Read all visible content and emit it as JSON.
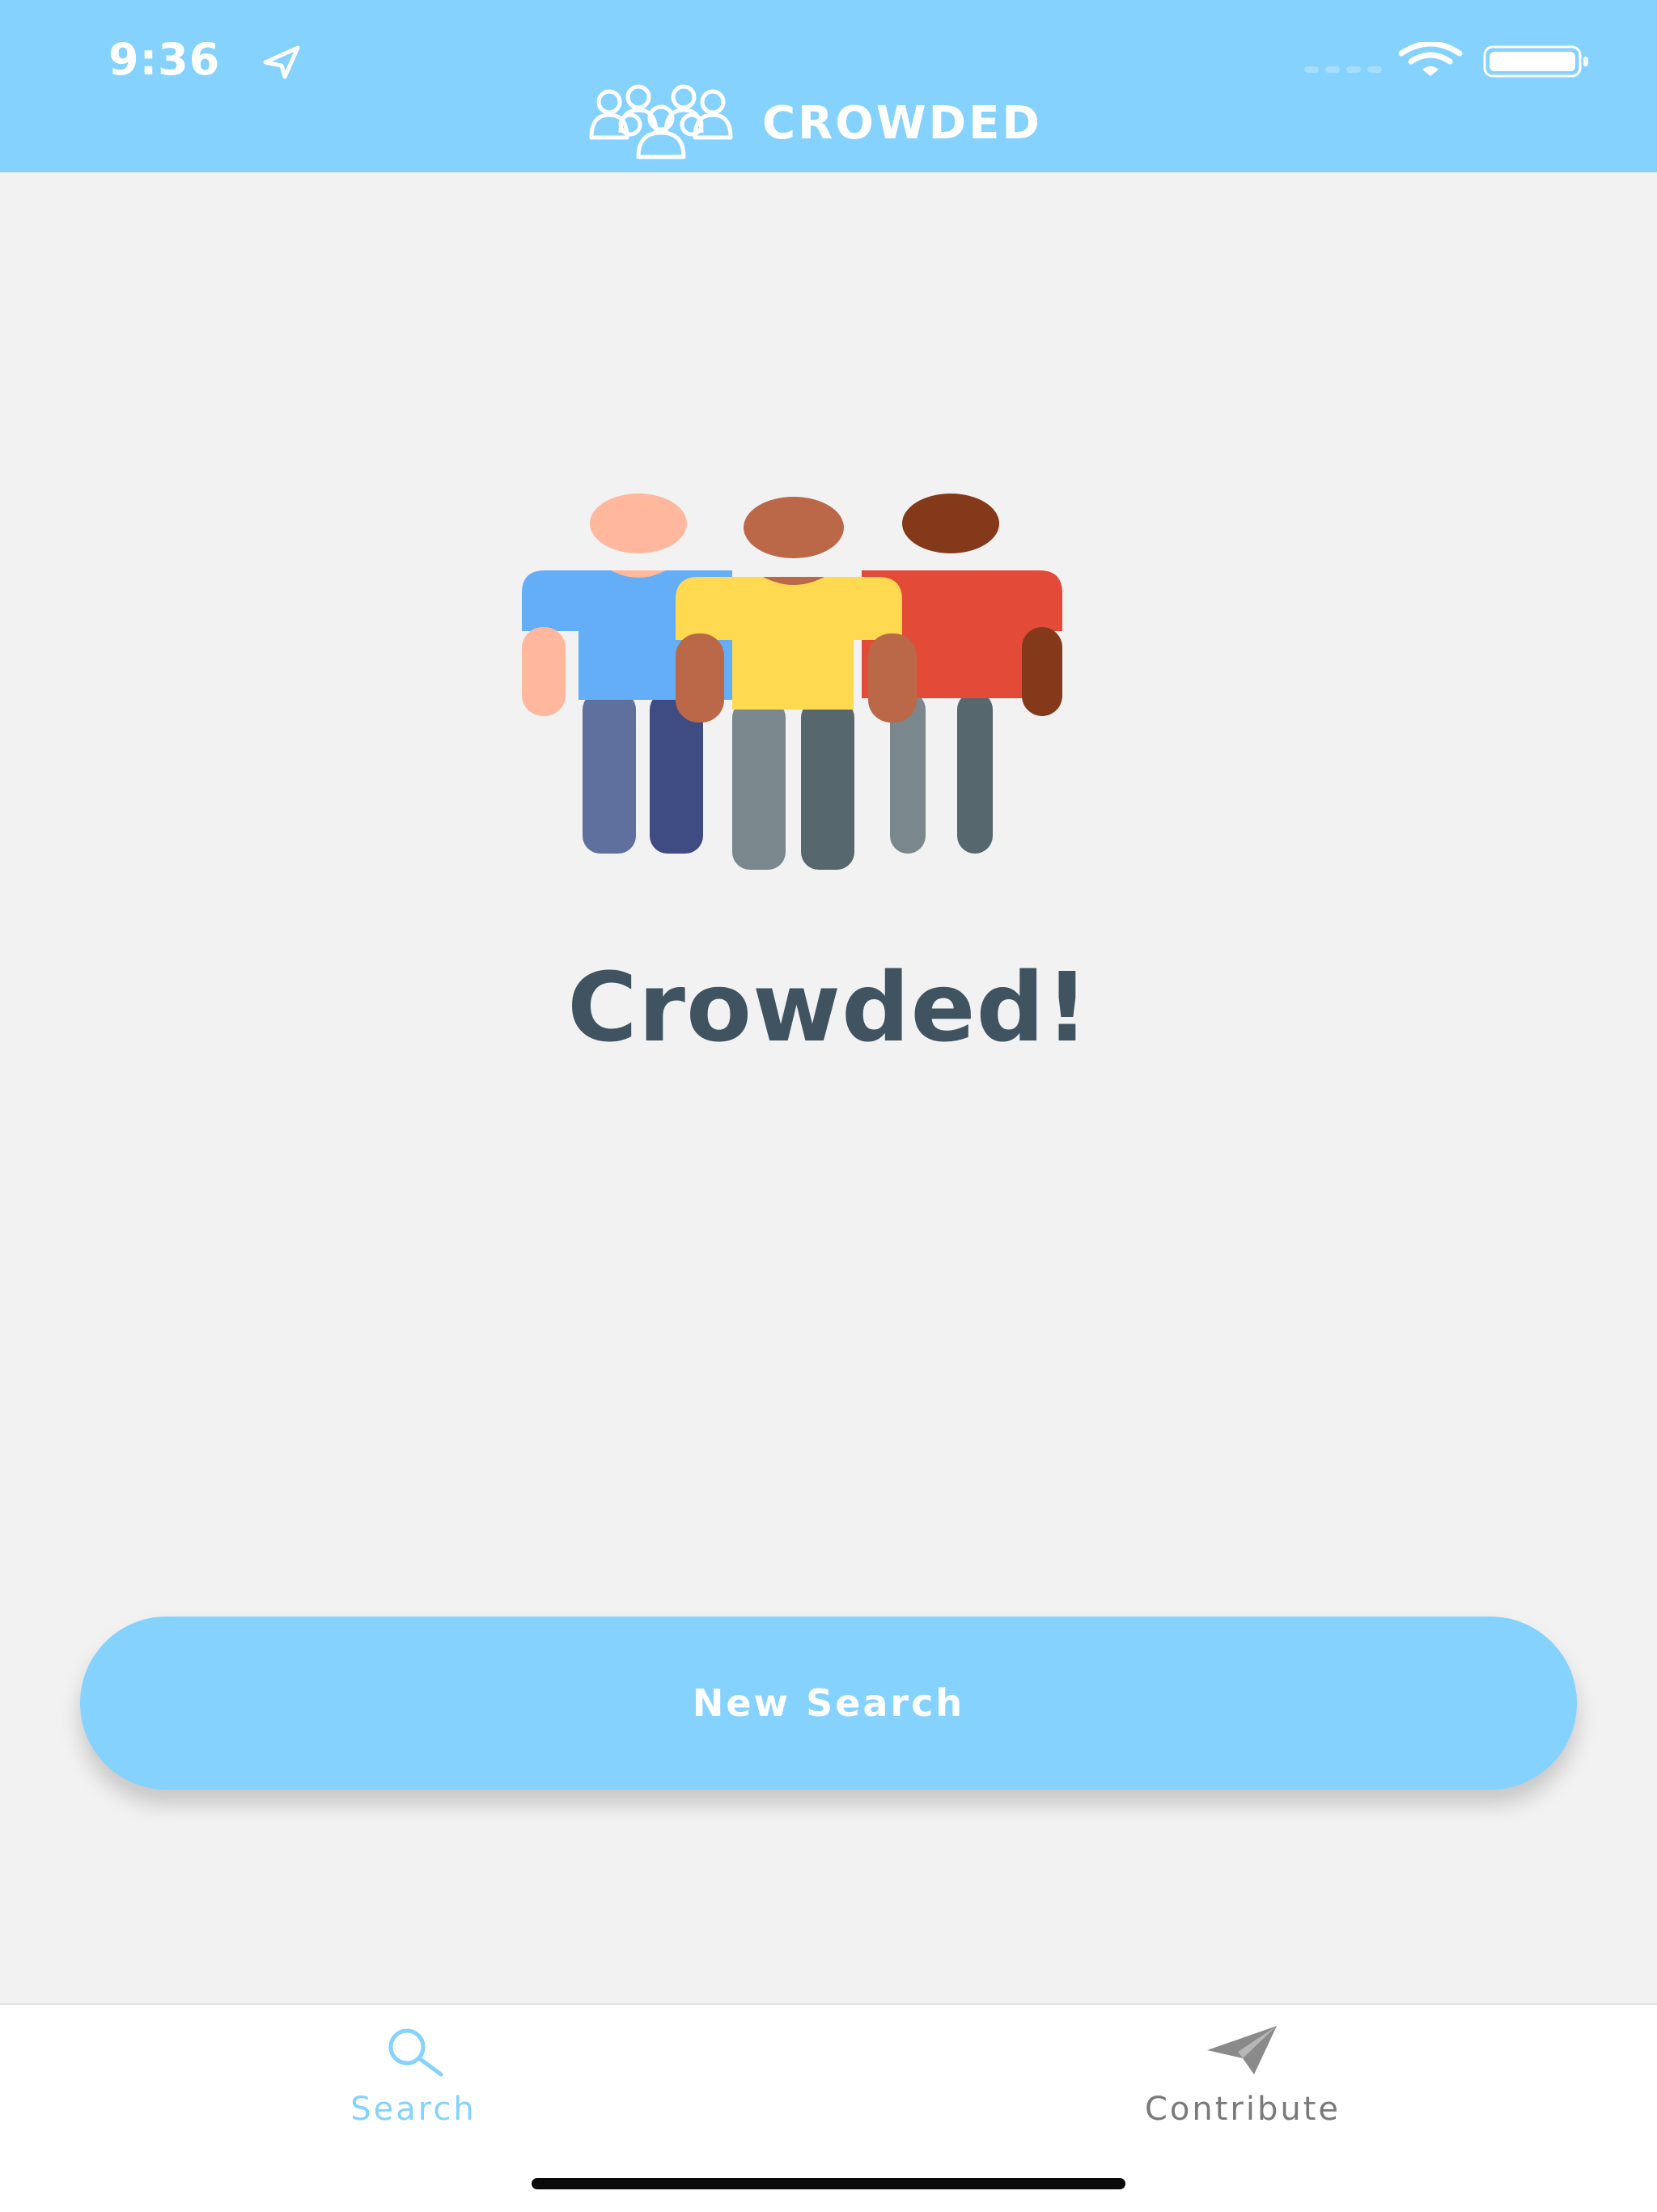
{
  "status_bar": {
    "time": "9:36",
    "icons": [
      "location-arrow-icon",
      "cellular-signal-icon",
      "wifi-icon",
      "battery-icon"
    ]
  },
  "header": {
    "app_name": "CROWDED",
    "logo_icon": "people-group-icon"
  },
  "main": {
    "illustration": "crowd-people-illustration",
    "title": "Crowded!",
    "primary_button_label": "New Search"
  },
  "tabbar": {
    "tabs": [
      {
        "label": "Search",
        "icon": "search-icon",
        "selected": true
      },
      {
        "label": "Contribute",
        "icon": "paper-plane-icon",
        "selected": false
      }
    ]
  },
  "colors": {
    "accent": "#84d2fd",
    "background": "#f2f2f2",
    "title_text": "#3f5360",
    "inactive_tab": "#7a7a7a"
  }
}
